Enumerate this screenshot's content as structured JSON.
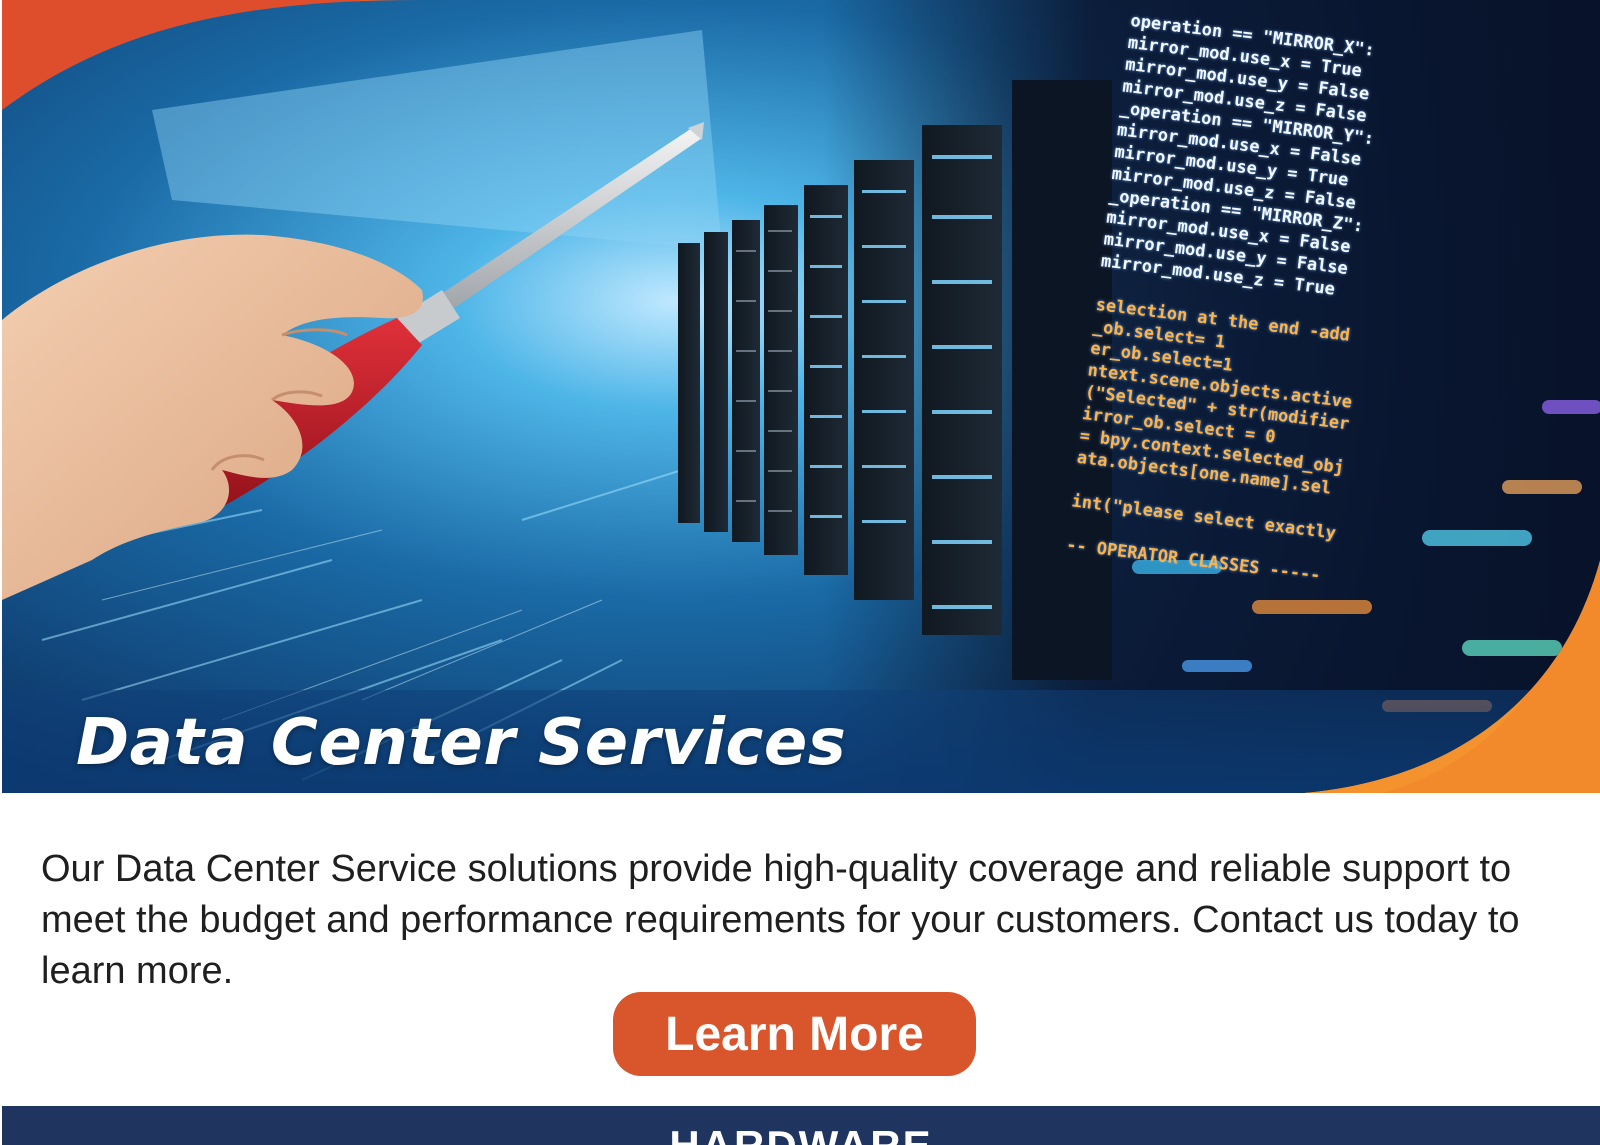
{
  "hero": {
    "title": "Data Center Services",
    "code_text": [
      "operation == \"MIRROR_X\":",
      "mirror_mod.use_x = True",
      "mirror_mod.use_y = False",
      "mirror_mod.use_z = False",
      "_operation == \"MIRROR_Y\":",
      "mirror_mod.use_x = False",
      "mirror_mod.use_y = True",
      "mirror_mod.use_z = False",
      "_operation == \"MIRROR_Z\":",
      "mirror_mod.use_x = False",
      "mirror_mod.use_y = False",
      "mirror_mod.use_z = True",
      "",
      "selection at the end -add",
      "_ob.select= 1",
      "er_ob.select=1",
      "ntext.scene.objects.active",
      "(\"Selected\" + str(modifier",
      "irror_ob.select = 0",
      "= bpy.context.selected_obj",
      "ata.objects[one.name].sel",
      "",
      "int(\"please select exactly",
      "",
      "-- OPERATOR CLASSES -----"
    ]
  },
  "content": {
    "description": "Our Data Center Service solutions provide high-quality coverage and reliable support to meet the budget and performance requirements for your customers. Contact us today to learn more."
  },
  "cta": {
    "label": "Learn More"
  },
  "section": {
    "label": "HARDWARE"
  },
  "colors": {
    "accent": "#d9552c",
    "hero_orange": "#f08a2c",
    "navy": "#1f3560",
    "hero_blue": "#1d6fa8"
  }
}
